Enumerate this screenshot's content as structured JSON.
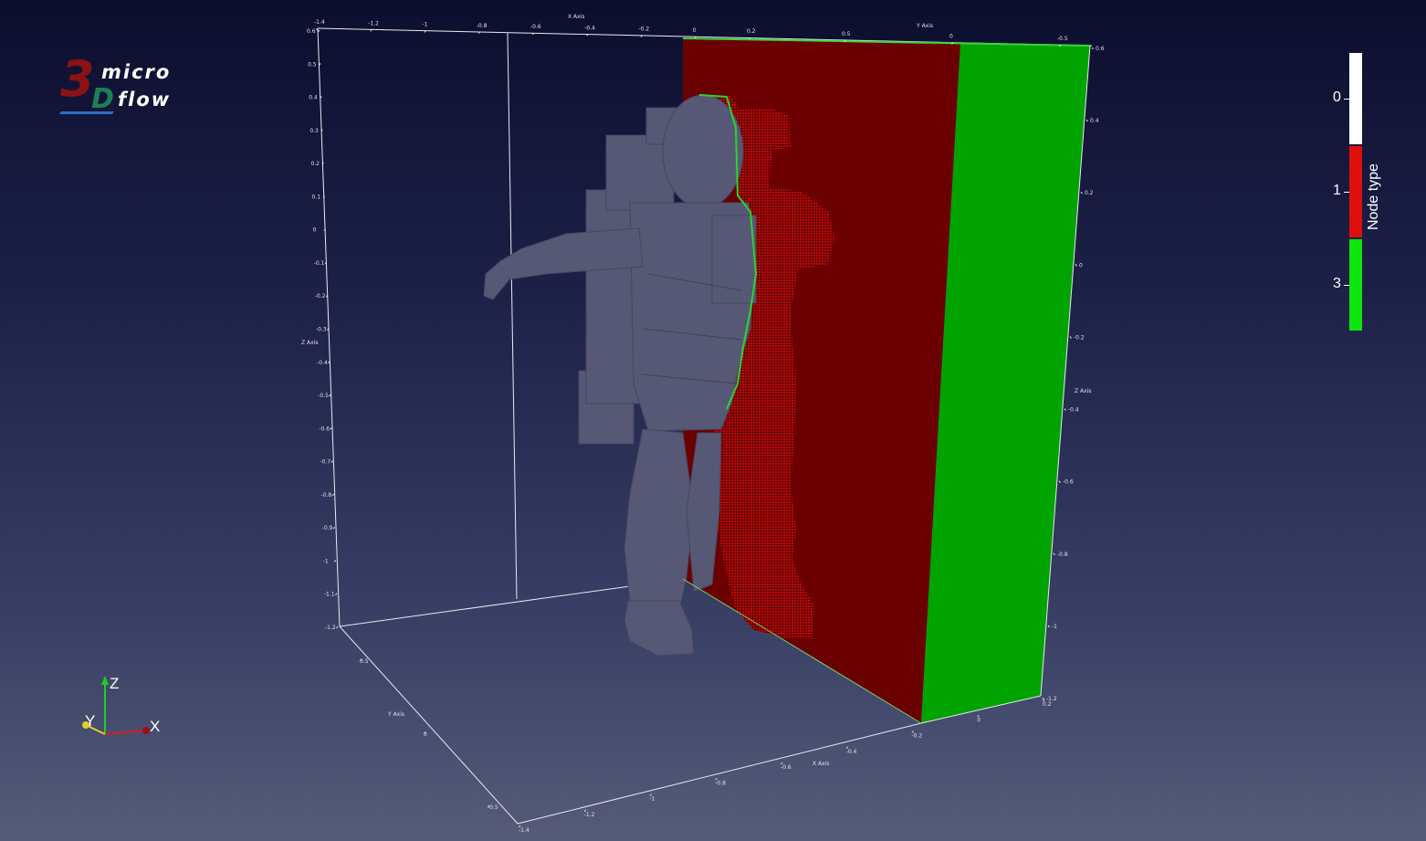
{
  "logo": {
    "digit": "3",
    "letter": "D",
    "word_top": "micro",
    "word_bottom": "flow"
  },
  "legend": {
    "title": "Node type",
    "entries": [
      {
        "label": "0",
        "color": "#ffffff"
      },
      {
        "label": "1",
        "color": "#e10e0e"
      },
      {
        "label": "3",
        "color": "#0ce60c"
      }
    ]
  },
  "scene": {
    "wall_red_color": "#6b0000",
    "wall_green_color": "#00a300",
    "voxel_color": "#c20000",
    "astronaut_color": "#565876"
  },
  "axes": {
    "x_title": "X Axis",
    "y_title": "Y Axis",
    "z_title": "Z Axis",
    "top_x_ticks": [
      "-1.4",
      "-1.2",
      "-1",
      "-0.8",
      "-0.6",
      "-0.4",
      "-0.2",
      "0",
      "0.2"
    ],
    "top_y_ticks": [
      "0.5",
      "0",
      "-0.5"
    ],
    "left_z_ticks": [
      "0.6",
      "0.5",
      "0.4",
      "0.3",
      "0.2",
      "0.1",
      "0",
      "-0.1",
      "-0.2",
      "-0.3",
      "-0.4",
      "-0.5",
      "-0.6",
      "-0.7",
      "-0.8",
      "-0.9",
      "-1",
      "-1.1",
      "-1.2"
    ],
    "right_z_ticks": [
      "0.6",
      "0.4",
      "0.2",
      "0",
      "-0.2",
      "-0.4",
      "-0.6",
      "-0.8",
      "-1",
      "-1.2"
    ],
    "bottom_x_ticks": [
      "-1.4",
      "-1.2",
      "-1",
      "-0.8",
      "-0.6",
      "-0.4",
      "-0.2",
      "0",
      "0.2"
    ],
    "bottom_y_ticks": [
      "0.5",
      "0",
      "-0.5"
    ]
  },
  "orientation": {
    "x_label": "X",
    "y_label": "Y",
    "z_label": "Z"
  }
}
